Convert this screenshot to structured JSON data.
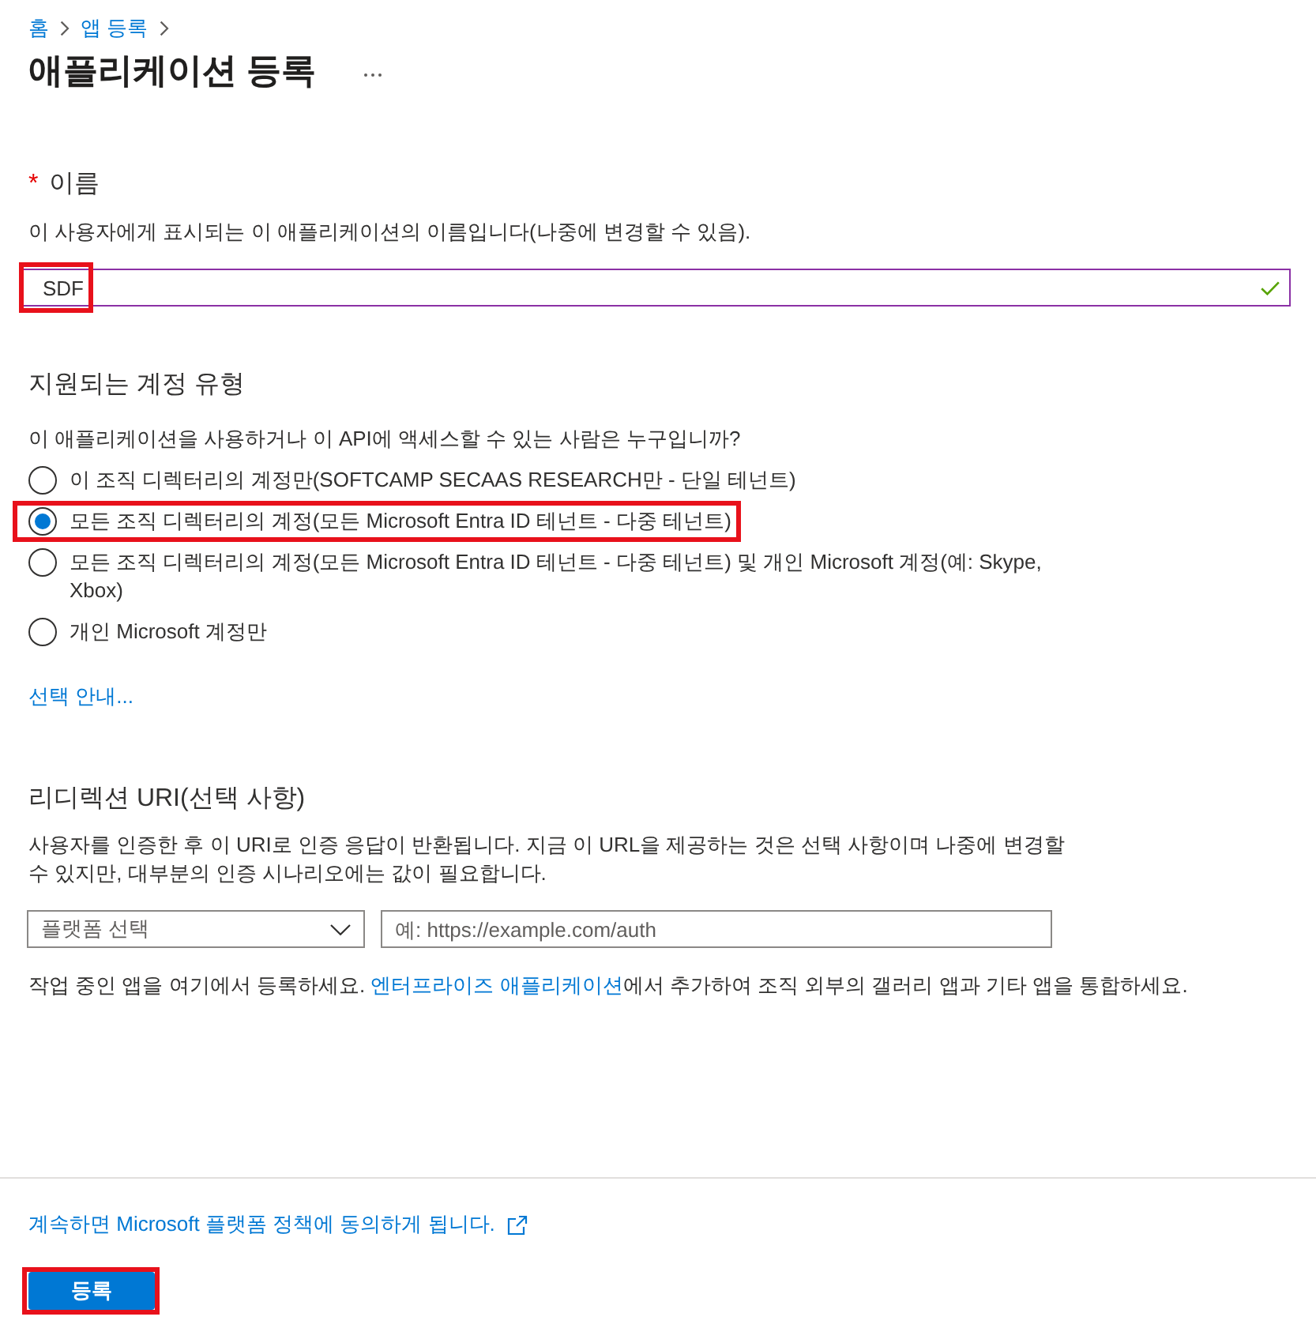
{
  "breadcrumb": [
    "홈",
    "앱 등록"
  ],
  "title": "애플리케이션 등록",
  "name_section": {
    "required_mark": "*",
    "label": "이름",
    "description": "이 사용자에게 표시되는 이 애플리케이션의 이름입니다(나중에 변경할 수 있음).",
    "input": {
      "value": "SDF",
      "focused": true,
      "valid": true,
      "highlighted": true
    }
  },
  "account_types": {
    "heading": "지원되는 계정 유형",
    "question": "이 애플리케이션을 사용하거나 이 API에 액세스할 수 있는 사람은 누구입니까?",
    "options": [
      {
        "label": "이 조직 디렉터리의 계정만(SOFTCAMP SECAAS RESEARCH만 - 단일 테넌트)",
        "selected": false,
        "highlighted": false
      },
      {
        "label": "모든 조직 디렉터리의 계정(모든 Microsoft Entra ID 테넌트 - 다중 테넌트)",
        "selected": true,
        "highlighted": true
      },
      {
        "label": "모든 조직 디렉터리의 계정(모든 Microsoft Entra ID 테넌트 - 다중 테넌트) 및 개인 Microsoft 계정(예: Skype, Xbox)",
        "selected": false,
        "highlighted": false
      },
      {
        "label": "개인 Microsoft 계정만",
        "selected": false,
        "highlighted": false
      }
    ],
    "help_link": "선택 안내..."
  },
  "redirect_uri": {
    "heading": "리디렉션 URI(선택 사항)",
    "description": "사용자를 인증한 후 이 URI로 인증 응답이 반환됩니다. 지금 이 URL을 제공하는 것은 선택 사항이며 나중에 변경할 수 있지만, 대부분의 인증 시나리오에는 값이 필요합니다.",
    "platform_select": {
      "placeholder": "플랫폼 선택"
    },
    "uri_input": {
      "placeholder": "예: https://example.com/auth"
    }
  },
  "note": {
    "before": "작업 중인 앱을 여기에서 등록하세요. ",
    "link": "엔터프라이즈 애플리케이션",
    "after": "에서 추가하여 조직 외부의 갤러리 앱과 기타 앱을 통합하세요."
  },
  "footer": {
    "policy_link": "계속하면 Microsoft 플랫폼 정책에 동의하게 됩니다.",
    "register_button": {
      "label": "등록",
      "highlighted": true
    }
  }
}
